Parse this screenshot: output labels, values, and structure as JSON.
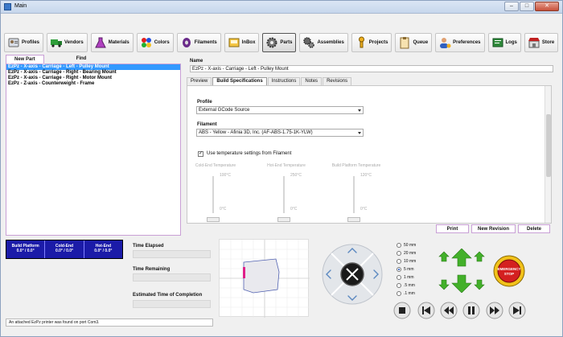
{
  "window": {
    "title": "Main",
    "minimize": "–",
    "maximize": "□",
    "close": "✕"
  },
  "toolbar": [
    {
      "label": "Profiles",
      "icon": "profiles-icon"
    },
    {
      "label": "Vendors",
      "icon": "truck-icon"
    },
    {
      "label": "Materials",
      "icon": "flask-icon"
    },
    {
      "label": "Colors",
      "icon": "color-balls-icon"
    },
    {
      "label": "Filaments",
      "icon": "spool-icon"
    },
    {
      "label": "InBox",
      "icon": "inbox-icon"
    },
    {
      "label": "Parts",
      "icon": "gear-icon"
    },
    {
      "label": "Assemblies",
      "icon": "gears-icon"
    },
    {
      "label": "Projects",
      "icon": "wrench-icon"
    },
    {
      "label": "Queue",
      "icon": "clipboard-icon"
    },
    {
      "label": "Preferences",
      "icon": "user-preferences-icon"
    },
    {
      "label": "Logs",
      "icon": "logs-icon"
    },
    {
      "label": "Store",
      "icon": "store-icon"
    }
  ],
  "left": {
    "tab_new": "New Part",
    "tab_find": "Find",
    "parts": [
      "EzPz - X-axis - Carriage - Left - Pulley Mount",
      "EzPz - X-axis - Carriage - Right - Bearing Mount",
      "EzPz - X-axis - Carriage - Right - Motor Mount",
      "EzPz - Z-axis - Counterweight - Frame"
    ]
  },
  "detail": {
    "name_label": "Name",
    "name_value": "EzPz - X-axis - Carriage - Left - Pulley Mount",
    "tabs": [
      "Preview",
      "Build Specifications",
      "Instructions",
      "Notes",
      "Revisions"
    ],
    "profile_label": "Profile",
    "profile_value": "External GCode Source",
    "filament_label": "Filament",
    "filament_value": "ABS - Yellow - Afinia 3D, Inc. (AF-ABS-1.75-1K-YLW)",
    "use_temp_label": "Use temperature settings from Filament",
    "temps": [
      {
        "title": "Cold-End Temperature",
        "max": "100°C",
        "min": "0°C"
      },
      {
        "title": "Hot-End Temperature",
        "max": "250°C",
        "min": "0°C"
      },
      {
        "title": "Build Platform Temperature",
        "max": "120°C",
        "min": "0°C"
      }
    ]
  },
  "actions": {
    "print": "Print",
    "new_revision": "New Revision",
    "delete": "Delete"
  },
  "status_tiles": [
    {
      "title": "Build Platform",
      "value": "0.0° / 0.0°"
    },
    {
      "title": "Cold-End",
      "value": "0.0° / 0.0°"
    },
    {
      "title": "Hot-End",
      "value": "0.0° / 0.0°"
    }
  ],
  "times": {
    "elapsed": "Time Elapsed",
    "remaining": "Time Remaining",
    "completion": "Estimated Time of Completion"
  },
  "steps": [
    "50 mm",
    "20 mm",
    "10 mm",
    "5 mm",
    "1 mm",
    ".5 mm",
    ".1 mm"
  ],
  "selected_step": "5 mm",
  "estop": {
    "line1": "EMERGENCY",
    "line2": "STOP"
  },
  "status_message": "An attached EzPz printer was found on port Com3.",
  "colors": {
    "accent": "#c9a0d6",
    "selection": "#3399ff",
    "tiles": "#1b1ba8",
    "arrows": "#43b02a",
    "estop": "#d42020"
  }
}
